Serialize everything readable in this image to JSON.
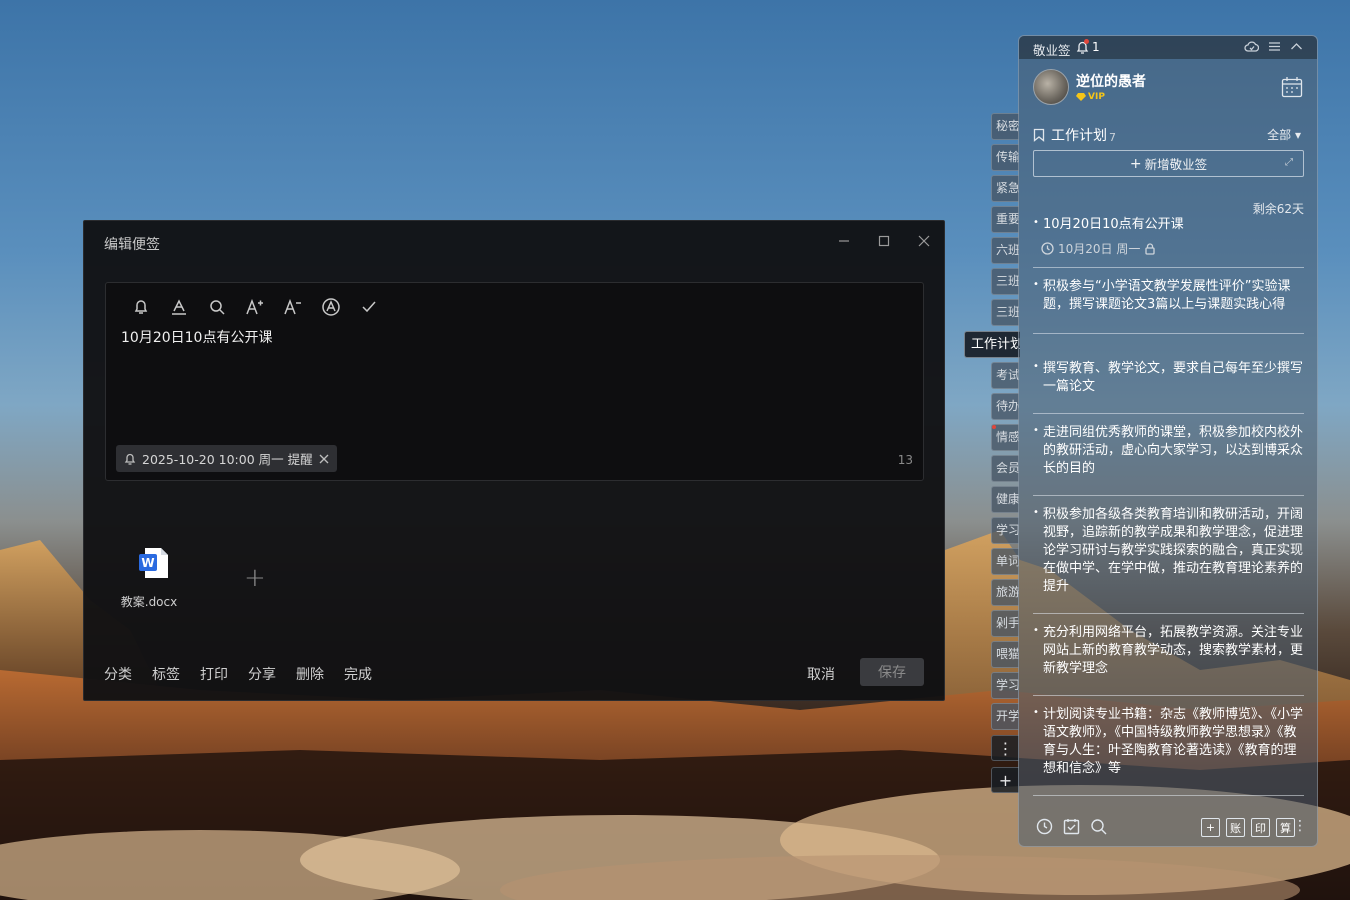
{
  "editor": {
    "title": "编辑便签",
    "note_text": "10月20日10点有公开课",
    "reminder": "2025-10-20 10:00 周一 提醒",
    "char_count": "13",
    "attachment_name": "教案.docx",
    "add_attachment": "+",
    "actions": [
      "分类",
      "标签",
      "打印",
      "分享",
      "删除",
      "完成"
    ],
    "cancel": "取消",
    "save": "保存",
    "toolbar_icons": [
      "bell-icon",
      "text-color-icon",
      "search-icon",
      "font-increase-icon",
      "font-decrease-icon",
      "auto-format-icon",
      "check-icon"
    ]
  },
  "tabs": [
    {
      "label": "秘密"
    },
    {
      "label": "传输"
    },
    {
      "label": "紧急"
    },
    {
      "label": "重要"
    },
    {
      "label": "六班"
    },
    {
      "label": "三班"
    },
    {
      "label": "三班"
    },
    {
      "label": "工作计划"
    },
    {
      "label": "考试"
    },
    {
      "label": "待办"
    },
    {
      "label": "情感"
    },
    {
      "label": "会员"
    },
    {
      "label": "健康"
    },
    {
      "label": "学习"
    },
    {
      "label": "单词"
    },
    {
      "label": "旅游"
    },
    {
      "label": "剁手"
    },
    {
      "label": "喂猫"
    },
    {
      "label": "学习"
    },
    {
      "label": "开学"
    }
  ],
  "tab_more": "⋮",
  "tab_add": "+",
  "panel": {
    "app_name": "敬业签",
    "notification_count": "1",
    "username": "逆位的愚者",
    "vip": "VIP",
    "category": "工作计划",
    "category_count": "7",
    "filter": "全部 ▾",
    "new_note": "新增敬业签",
    "countdown": "剩余62天",
    "notes": [
      {
        "text": "10月20日10点有公开课",
        "meta": "10月20日 周一"
      },
      {
        "text": "积极参与“小学语文教学发展性评价”实验课题，撰写课题论文3篇以上与课题实践心得"
      },
      {
        "text": "撰写教育、教学论文，要求自己每年至少撰写一篇论文"
      },
      {
        "text": "走进同组优秀教师的课堂，积极参加校内校外的教研活动，虚心向大家学习，以达到博采众长的目的"
      },
      {
        "text": "积极参加各级各类教育培训和教研活动，开阔视野，追踪新的教学成果和教学理念，促进理论学习研讨与教学实践探索的融合，真正实现在做中学、在学中做，推动在教育理论素养的提升"
      },
      {
        "text": "充分利用网络平台，拓展教学资源。关注专业网站上新的教育教学动态，搜索教学素材，更新教学理念"
      },
      {
        "text": "计划阅读专业书籍：杂志《教师博览》、《小学语文教师》，《中国特级教师教学思想录》《教育与人生：叶圣陶教育论著选读》《教育的理想和信念》等"
      }
    ],
    "bottom_boxes": [
      "+",
      "账",
      "印",
      "算"
    ]
  }
}
